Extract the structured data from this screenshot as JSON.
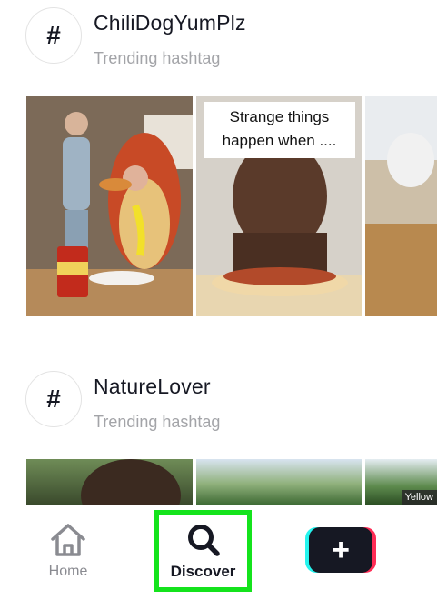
{
  "sections": [
    {
      "hashtag_symbol": "#",
      "title": "ChiliDogYumPlz",
      "subtitle": "Trending hashtag",
      "thumb_caption": "Strange things happen when ...."
    },
    {
      "hashtag_symbol": "#",
      "title": "NatureLover",
      "subtitle": "Trending hashtag",
      "thumb_caption": "Yellow"
    }
  ],
  "tabbar": {
    "home_label": "Home",
    "discover_label": "Discover",
    "create_symbol": "+"
  },
  "colors": {
    "text_primary": "#161823",
    "text_secondary": "#a3a4a8",
    "highlight": "#14e31c",
    "tiktok_cyan": "#25f4ee",
    "tiktok_red": "#fe2c55"
  },
  "icons": [
    "hashtag-icon",
    "home-icon",
    "search-icon",
    "plus-icon"
  ]
}
